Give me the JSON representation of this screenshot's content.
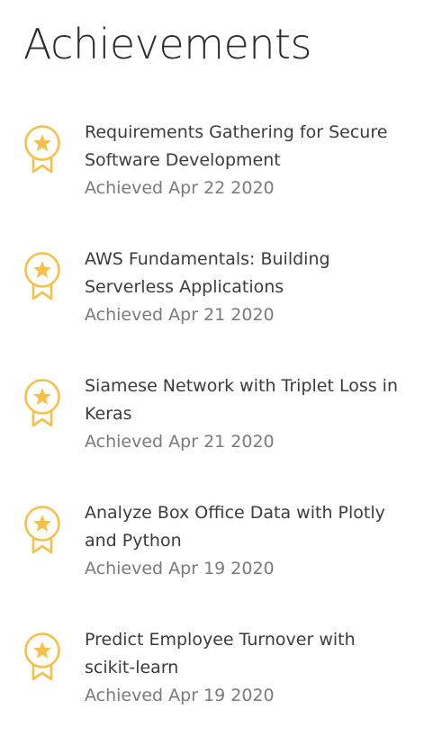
{
  "page": {
    "title": "Achievements"
  },
  "colors": {
    "badge": "#f5c04a",
    "title_text": "#2b2b2b",
    "name_text": "#3c3c3c",
    "date_text": "#7a7a7a"
  },
  "achievements": [
    {
      "icon": "award-badge-icon",
      "name": "Requirements Gathering for Secure Software Development",
      "date": "Achieved Apr 22 2020"
    },
    {
      "icon": "award-badge-icon",
      "name": "AWS Fundamentals: Building Serverless Applications",
      "date": "Achieved Apr 21 2020"
    },
    {
      "icon": "award-badge-icon",
      "name": "Siamese Network with Triplet Loss in Keras",
      "date": "Achieved Apr 21 2020"
    },
    {
      "icon": "award-badge-icon",
      "name": "Analyze Box Office Data with Plotly and Python",
      "date": "Achieved Apr 19 2020"
    },
    {
      "icon": "award-badge-icon",
      "name": "Predict Employee Turnover with scikit-learn",
      "date": "Achieved Apr 19 2020"
    }
  ]
}
